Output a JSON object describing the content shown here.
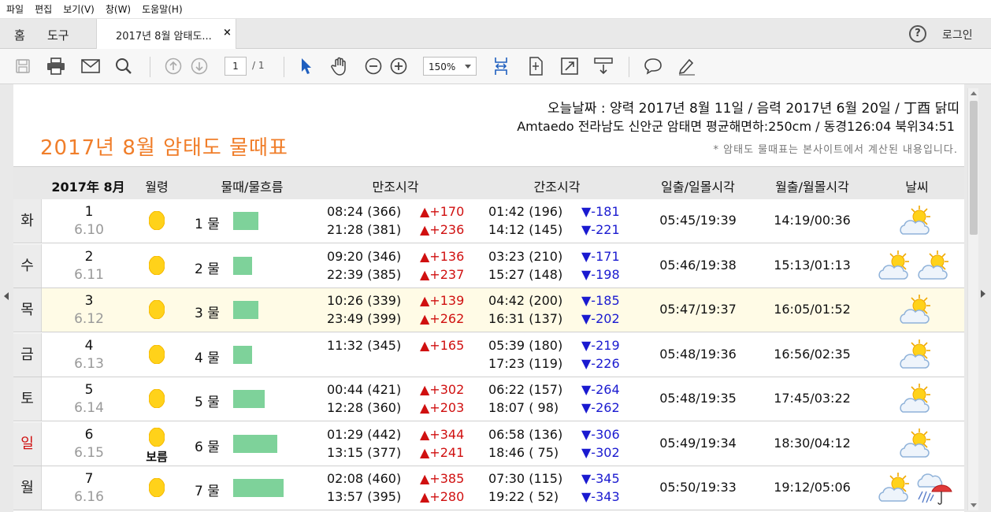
{
  "menu": [
    "파일",
    "편집",
    "보기(V)",
    "창(W)",
    "도움말(H)"
  ],
  "tabs": {
    "home": "홈",
    "tools": "도구",
    "doc_title": "2017년 8월 암태도...",
    "close": "×"
  },
  "header_right": {
    "help": "?",
    "login": "로그인"
  },
  "toolbar": {
    "page_current": "1",
    "page_total": "/ 1",
    "zoom": "150%"
  },
  "doc": {
    "line1": "오늘날짜 : 양력 2017년 8월 11일 / 음력 2017년 6월 20일 / 丁酉 닭띠",
    "line2": "Amtaedo 전라남도 신안군 암태면 평균해면하:250cm / 동경126:04 북위34:51",
    "title": "2017년 8월 암태도 물때표",
    "note": "* 암태도 물때표는 본사이트에서 계산된 내용입니다."
  },
  "table": {
    "headers": [
      "2017年 8月",
      "월령",
      "물때/물흐름",
      "만조시각",
      "간조시각",
      "일출/일몰시각",
      "월출/월몰시각",
      "날씨"
    ],
    "rows": [
      {
        "dow": "화",
        "day": "1",
        "lunar": "6.10",
        "moon_label": "",
        "tide": "1 물",
        "tide_level": 0.33,
        "high1": "08:24 (366)",
        "highd1": "▲+170",
        "high2": "21:28 (381)",
        "highd2": "▲+236",
        "low1": "01:42 (196)",
        "lowd1": "▼-181",
        "low2": "14:12 (145)",
        "lowd2": "▼-221",
        "sun": "05:45/19:39",
        "moon": "14:19/00:36",
        "weather": [
          "partly-cloudy-icon"
        ]
      },
      {
        "dow": "수",
        "day": "2",
        "lunar": "6.11",
        "moon_label": "",
        "tide": "2 물",
        "tide_level": 0.25,
        "high1": "09:20 (346)",
        "highd1": "▲+136",
        "high2": "22:39 (385)",
        "highd2": "▲+237",
        "low1": "03:23 (210)",
        "lowd1": "▼-171",
        "low2": "15:27 (148)",
        "lowd2": "▼-198",
        "sun": "05:46/19:38",
        "moon": "15:13/01:13",
        "weather": [
          "partly-cloudy-icon",
          "partly-cloudy-icon"
        ]
      },
      {
        "dow": "목",
        "day": "3",
        "lunar": "6.12",
        "moon_label": "",
        "tide": "3 물",
        "tide_level": 0.33,
        "high1": "10:26 (339)",
        "highd1": "▲+139",
        "high2": "23:49 (399)",
        "highd2": "▲+262",
        "low1": "04:42 (200)",
        "lowd1": "▼-185",
        "low2": "16:31 (137)",
        "lowd2": "▼-202",
        "sun": "05:47/19:37",
        "moon": "16:05/01:52",
        "weather": [
          "partly-cloudy-icon"
        ]
      },
      {
        "dow": "금",
        "day": "4",
        "lunar": "6.13",
        "moon_label": "",
        "tide": "4 물",
        "tide_level": 0.25,
        "high1": "11:32 (345)",
        "highd1": "▲+165",
        "high2": "",
        "highd2": "",
        "low1": "05:39 (180)",
        "lowd1": "▼-219",
        "low2": "17:23 (119)",
        "lowd2": "▼-226",
        "sun": "05:48/19:36",
        "moon": "16:56/02:35",
        "weather": [
          "partly-cloudy-icon"
        ]
      },
      {
        "dow": "토",
        "day": "5",
        "lunar": "6.14",
        "moon_label": "",
        "tide": "5 물",
        "tide_level": 0.42,
        "high1": "00:44 (421)",
        "highd1": "▲+302",
        "high2": "12:28 (360)",
        "highd2": "▲+203",
        "low1": "06:22 (157)",
        "lowd1": "▼-264",
        "low2": "18:07 ( 98)",
        "lowd2": "▼-262",
        "sun": "05:48/19:35",
        "moon": "17:45/03:22",
        "weather": [
          "partly-cloudy-icon"
        ]
      },
      {
        "dow": "일",
        "day": "6",
        "lunar": "6.15",
        "moon_label": "보름",
        "tide": "6 물",
        "tide_level": 0.58,
        "high1": "01:29 (442)",
        "highd1": "▲+344",
        "high2": "13:15 (377)",
        "highd2": "▲+241",
        "low1": "06:58 (136)",
        "lowd1": "▼-306",
        "low2": "18:46 ( 75)",
        "lowd2": "▼-302",
        "sun": "05:49/19:34",
        "moon": "18:30/04:12",
        "weather": [
          "partly-cloudy-icon"
        ]
      },
      {
        "dow": "월",
        "day": "7",
        "lunar": "6.16",
        "moon_label": "",
        "tide": "7 물",
        "tide_level": 0.67,
        "high1": "02:08 (460)",
        "highd1": "▲+385",
        "high2": "13:57 (395)",
        "highd2": "▲+280",
        "low1": "07:30 (115)",
        "lowd1": "▼-345",
        "low2": "19:22 ( 52)",
        "lowd2": "▼-343",
        "sun": "05:50/19:33",
        "moon": "19:12/05:06",
        "weather": [
          "partly-cloudy-icon",
          "rain-umbrella-icon"
        ]
      }
    ]
  },
  "colors": {
    "title": "#f07e2a",
    "rise": "#d01010",
    "fall": "#1a1ad0",
    "tide_bar": "#7ed29a",
    "sunday": "#d01010"
  }
}
